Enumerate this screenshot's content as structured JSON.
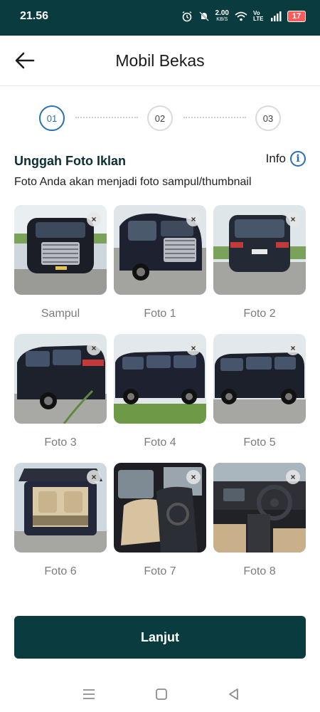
{
  "status_bar": {
    "time": "21.56",
    "speed_value": "2.00",
    "speed_unit": "KB/S",
    "network_tag": "Vo LTE",
    "battery": "17",
    "icons": [
      "alarm-icon",
      "mute-icon",
      "wifi-icon",
      "signal-icon",
      "battery-icon"
    ]
  },
  "app_bar": {
    "title": "Mobil Bekas",
    "back_icon": "arrow-left-icon"
  },
  "stepper": {
    "steps": [
      "01",
      "02",
      "03"
    ],
    "active_index": 0
  },
  "section": {
    "title": "Unggah Foto Iklan",
    "info_label": "Info",
    "subtitle": "Foto Anda akan menjadi foto sampul/thumbnail"
  },
  "photos": [
    {
      "caption": "Sampul"
    },
    {
      "caption": "Foto 1"
    },
    {
      "caption": "Foto 2"
    },
    {
      "caption": "Foto 3"
    },
    {
      "caption": "Foto 4"
    },
    {
      "caption": "Foto 5"
    },
    {
      "caption": "Foto 6"
    },
    {
      "caption": "Foto 7"
    },
    {
      "caption": "Foto 8"
    }
  ],
  "remove_symbol": "×",
  "primary_button": {
    "label": "Lanjut"
  },
  "colors": {
    "brand": "#0a3b3e",
    "accent": "#2a6fb4"
  }
}
